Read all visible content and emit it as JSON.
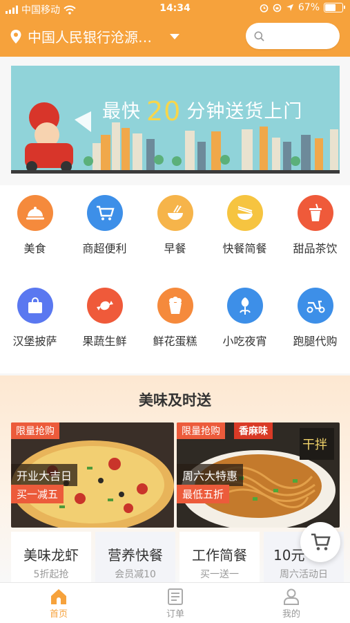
{
  "status_bar": {
    "carrier": "中国移动",
    "time": "14:34",
    "battery": "67%",
    "battery_level": 0.67
  },
  "header": {
    "location": "中国人民银行沧源…",
    "search_placeholder": ""
  },
  "banner": {
    "prefix": "最快",
    "number": "20",
    "suffix": "分钟送货上门"
  },
  "categories": [
    {
      "label": "美食",
      "icon": "cloche-icon",
      "color": "#f58a3c"
    },
    {
      "label": "商超便利",
      "icon": "shopping-cart-icon",
      "color": "#3d8fe8"
    },
    {
      "label": "早餐",
      "icon": "noodle-bowl-icon",
      "color": "#f6b44a"
    },
    {
      "label": "快餐简餐",
      "icon": "rice-bowl-icon",
      "color": "#f6c440"
    },
    {
      "label": "甜品茶饮",
      "icon": "drink-cup-icon",
      "color": "#ef5a3a"
    },
    {
      "label": "汉堡披萨",
      "icon": "shopping-bag-icon",
      "color": "#5a78f0"
    },
    {
      "label": "果蔬生鲜",
      "icon": "candy-icon",
      "color": "#ef5a3a"
    },
    {
      "label": "鲜花蛋糕",
      "icon": "popcorn-icon",
      "color": "#f58a3c"
    },
    {
      "label": "小吃夜宵",
      "icon": "flower-icon",
      "color": "#3d8fe8"
    },
    {
      "label": "跑腿代购",
      "icon": "scooter-icon",
      "color": "#3d8fe8"
    }
  ],
  "promo": {
    "title": "美味及时送",
    "cards": [
      {
        "tag": "限量抢购",
        "headline": "开业大吉日",
        "offer": "买一减五"
      },
      {
        "tag": "限量抢购",
        "flavor": "香麻味",
        "headline": "周六大特惠",
        "offer": "最低五折"
      }
    ],
    "tiles": [
      {
        "title": "美味龙虾",
        "sub": "5折起抢"
      },
      {
        "title": "营养快餐",
        "sub": "会员减10"
      },
      {
        "title": "工作简餐",
        "sub": "买一送一"
      },
      {
        "title": "10元",
        "sub": "周六活动日"
      }
    ]
  },
  "tabbar": {
    "items": [
      {
        "label": "首页"
      },
      {
        "label": "订单"
      },
      {
        "label": "我的"
      }
    ]
  },
  "colors": {
    "brand": "#f6a23c",
    "tag_red": "#ec5b3b"
  }
}
